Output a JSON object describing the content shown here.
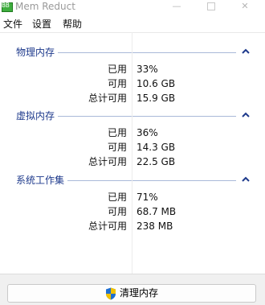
{
  "window": {
    "title": "Mem Reduct",
    "icon": "app-icon",
    "icon_text": "BB"
  },
  "menu": {
    "file": "文件",
    "settings": "设置",
    "help": "帮助"
  },
  "groups": [
    {
      "title": "物理内存",
      "rows": [
        {
          "label": "已用",
          "value": "33%"
        },
        {
          "label": "可用",
          "value": "10.6 GB"
        },
        {
          "label": "总计可用",
          "value": "15.9 GB"
        }
      ]
    },
    {
      "title": "虚拟内存",
      "rows": [
        {
          "label": "已用",
          "value": "36%"
        },
        {
          "label": "可用",
          "value": "14.3 GB"
        },
        {
          "label": "总计可用",
          "value": "22.5 GB"
        }
      ]
    },
    {
      "title": "系统工作集",
      "rows": [
        {
          "label": "已用",
          "value": "71%"
        },
        {
          "label": "可用",
          "value": "68.7 MB"
        },
        {
          "label": "总计可用",
          "value": "238 MB"
        }
      ]
    }
  ],
  "action": {
    "clean_label": "清理内存",
    "icon": "shield-icon"
  },
  "colors": {
    "group_title": "#1e3a8c",
    "group_line": "#a9b9d9",
    "shield_blue": "#1f6fd1",
    "shield_yellow": "#f2c200"
  }
}
